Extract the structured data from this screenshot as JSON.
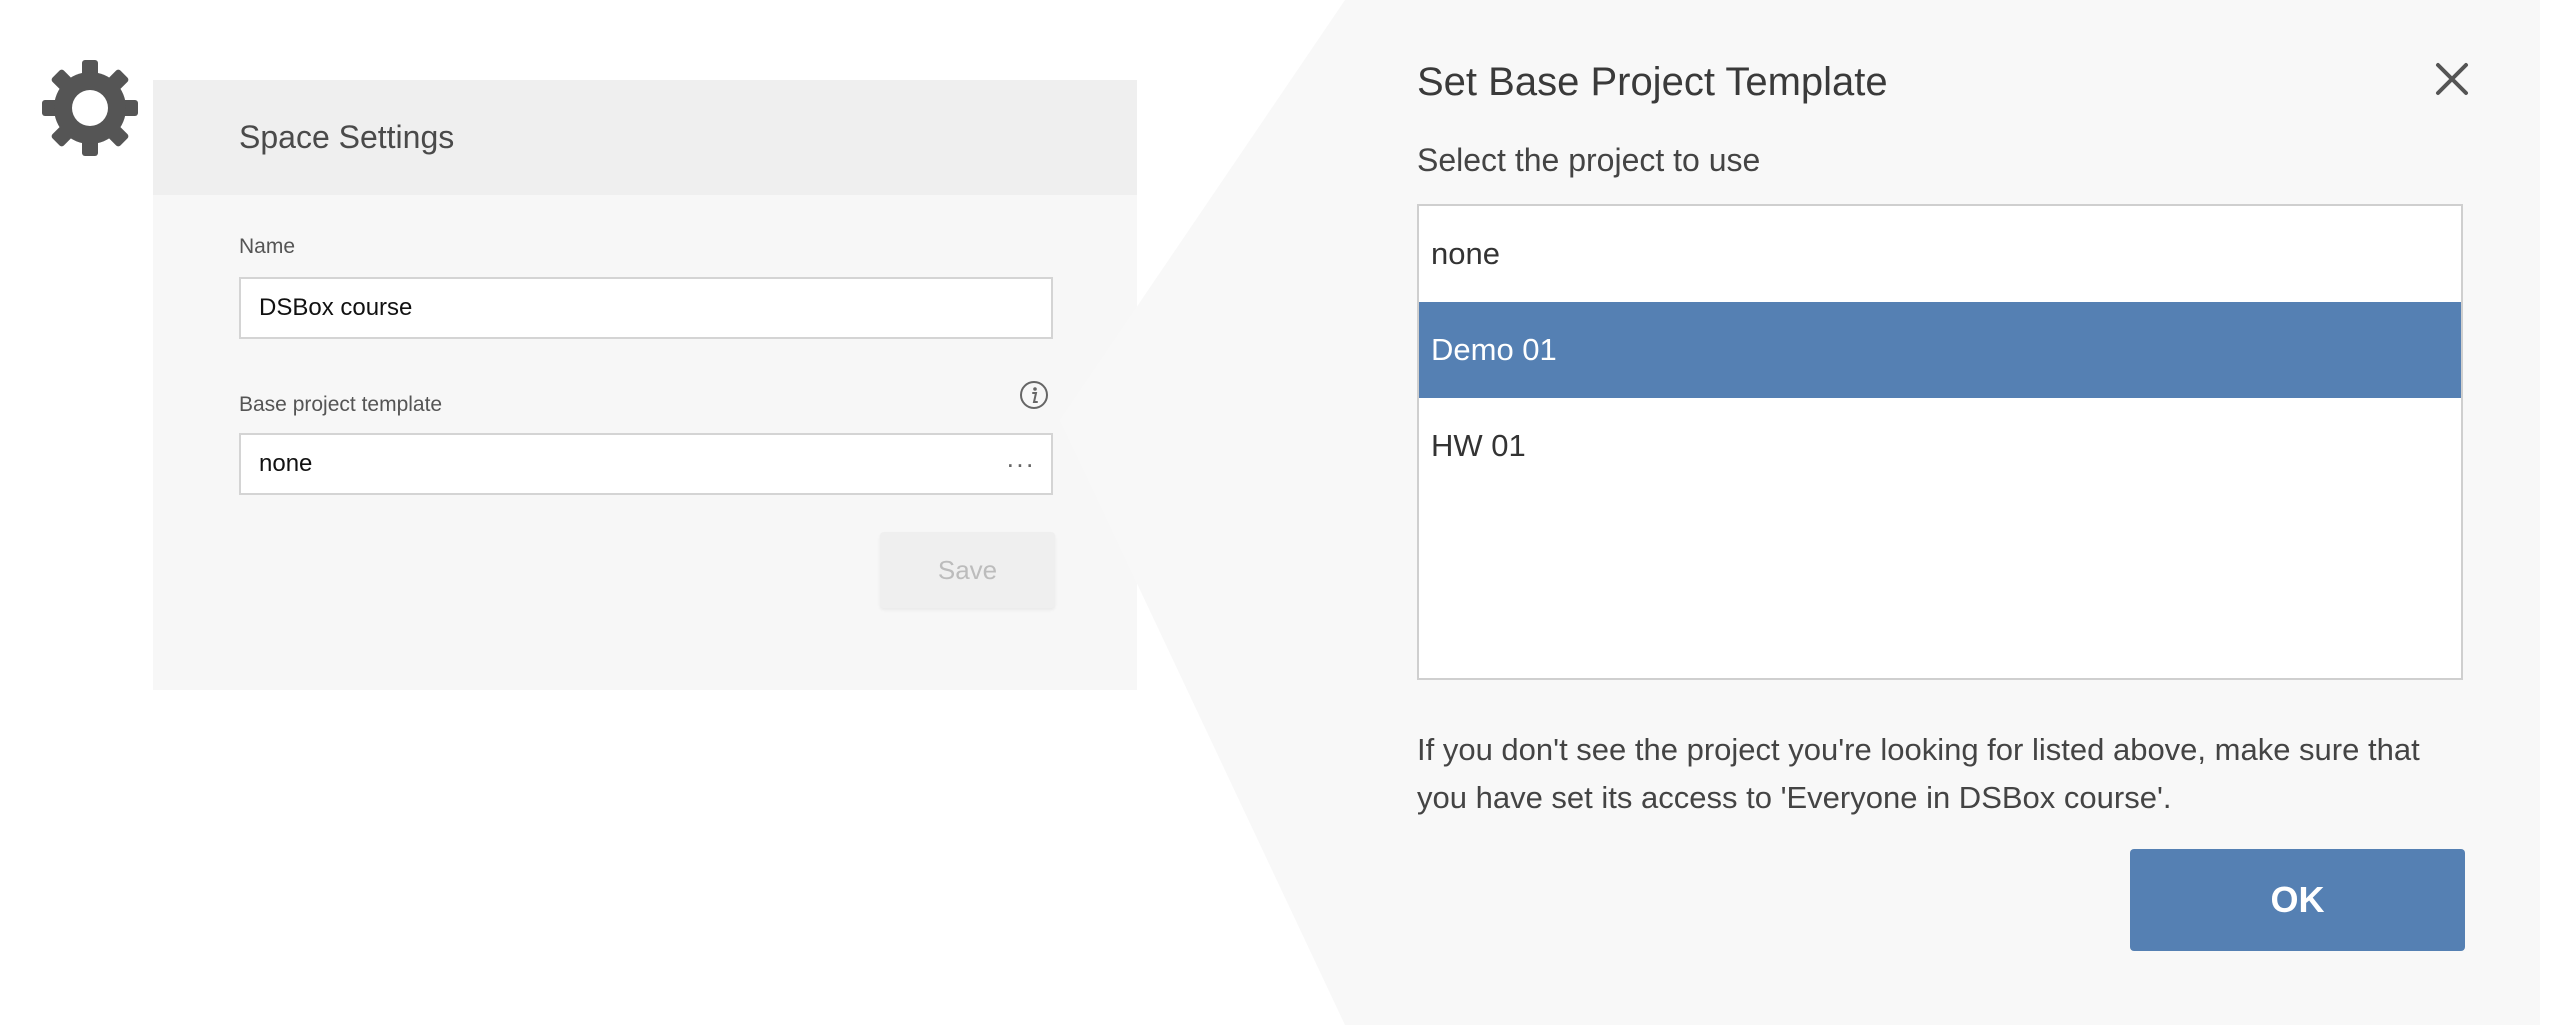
{
  "settings": {
    "title": "Space Settings",
    "name_label": "Name",
    "name_value": "DSBox course",
    "template_label": "Base project template",
    "template_value": "none",
    "more_label": "···",
    "save_label": "Save"
  },
  "dialog": {
    "title": "Set Base Project Template",
    "subtitle": "Select the project to use",
    "options": [
      {
        "label": "none",
        "selected": false
      },
      {
        "label": "Demo 01",
        "selected": true
      },
      {
        "label": "HW 01",
        "selected": false
      }
    ],
    "note": "If you don't see the project you're looking for listed above, make sure that you have set its access to 'Everyone in DSBox course'.",
    "ok_label": "OK"
  },
  "colors": {
    "accent": "#5580b3",
    "panel": "#f7f7f7",
    "header": "#efefef"
  },
  "icons": {
    "settings": "gear-icon",
    "info": "info-icon",
    "close": "close-icon",
    "more": "ellipsis-icon"
  }
}
